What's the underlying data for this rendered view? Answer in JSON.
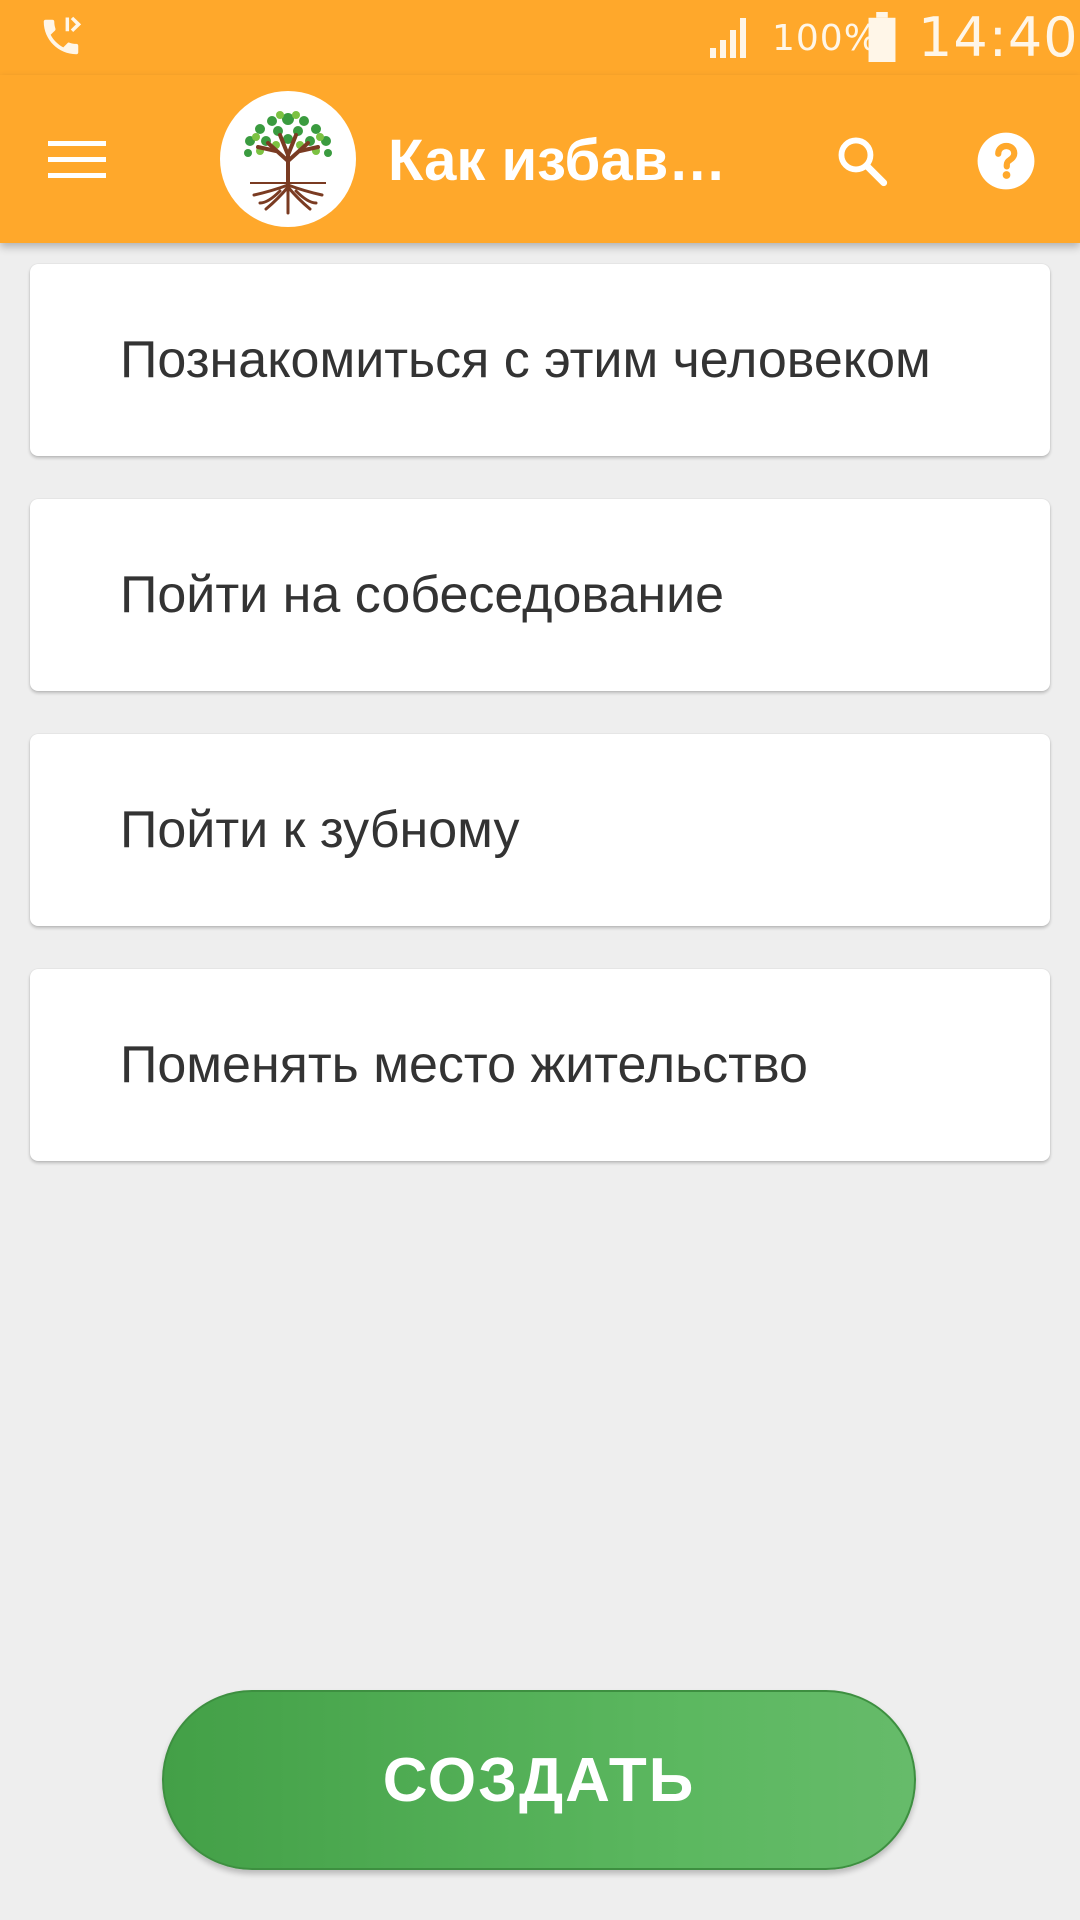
{
  "status_bar": {
    "call_icon": "call-forward-icon",
    "signal_icon": "signal-bars-icon",
    "battery_percent": "100%",
    "battery_icon": "battery-full-icon",
    "time": "14:40"
  },
  "app_bar": {
    "menu_icon": "hamburger-menu-icon",
    "logo": "tree-logo",
    "title": "Как избавиться",
    "search_icon": "search-icon",
    "help_icon": "help-circle-icon",
    "color": "#ffa82b"
  },
  "list": {
    "items": [
      {
        "label": "Познакомиться с этим человеком"
      },
      {
        "label": "Пойти на собеседование"
      },
      {
        "label": "Пойти к зубному"
      },
      {
        "label": "Поменять место жительство"
      }
    ]
  },
  "create_button": {
    "label": "СОЗДАТЬ",
    "color": "#4caf50"
  }
}
